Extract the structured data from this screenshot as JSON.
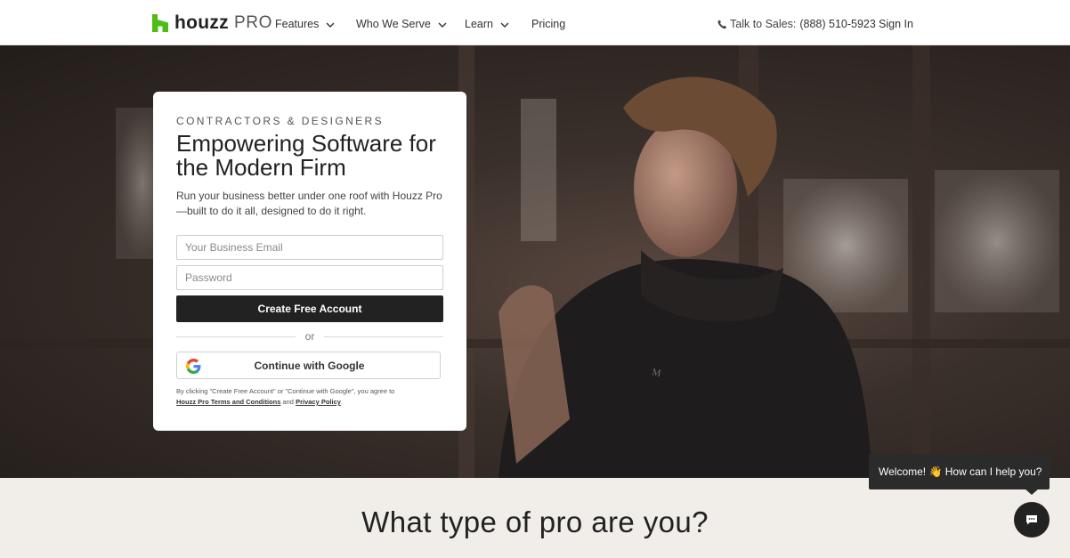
{
  "nav": {
    "logo_text": "houzz",
    "logo_suffix": "PRO",
    "brand_color": "#4dbc15",
    "items": [
      {
        "label": "Features",
        "icon": "chevron-down-icon"
      },
      {
        "label": "Who We Serve",
        "icon": "chevron-down-icon"
      },
      {
        "label": "Learn",
        "icon": "chevron-down-icon"
      },
      {
        "label": "Pricing"
      }
    ],
    "sales_label": "Talk to Sales:",
    "sales_phone": "(888) 510-5923",
    "phone_icon": "phone-icon",
    "signin_label": "Sign In"
  },
  "hero": {
    "eyebrow": "CONTRACTORS & DESIGNERS",
    "headline": "Empowering Software for the Modern Firm",
    "subtext": "Run your business better under one roof with Houzz Pro—built to do it all, designed to do it right.",
    "email_placeholder": "Your Business Email",
    "password_placeholder": "Password",
    "create_label": "Create Free Account",
    "or_label": "or",
    "google_label": "Continue with Google",
    "google_icon": "google-g-icon",
    "legal_prefix": "By clicking \"Create Free Account\" or \"Continue with Google\", you agree to",
    "legal_terms": "Houzz Pro Terms and Conditions",
    "legal_and": "and",
    "legal_privacy": "Privacy Policy",
    "legal_end": "."
  },
  "section": {
    "title": "What type of pro are you?"
  },
  "chat": {
    "welcome": "Welcome! 👋 How can I help you?",
    "icon": "chat-icon"
  }
}
